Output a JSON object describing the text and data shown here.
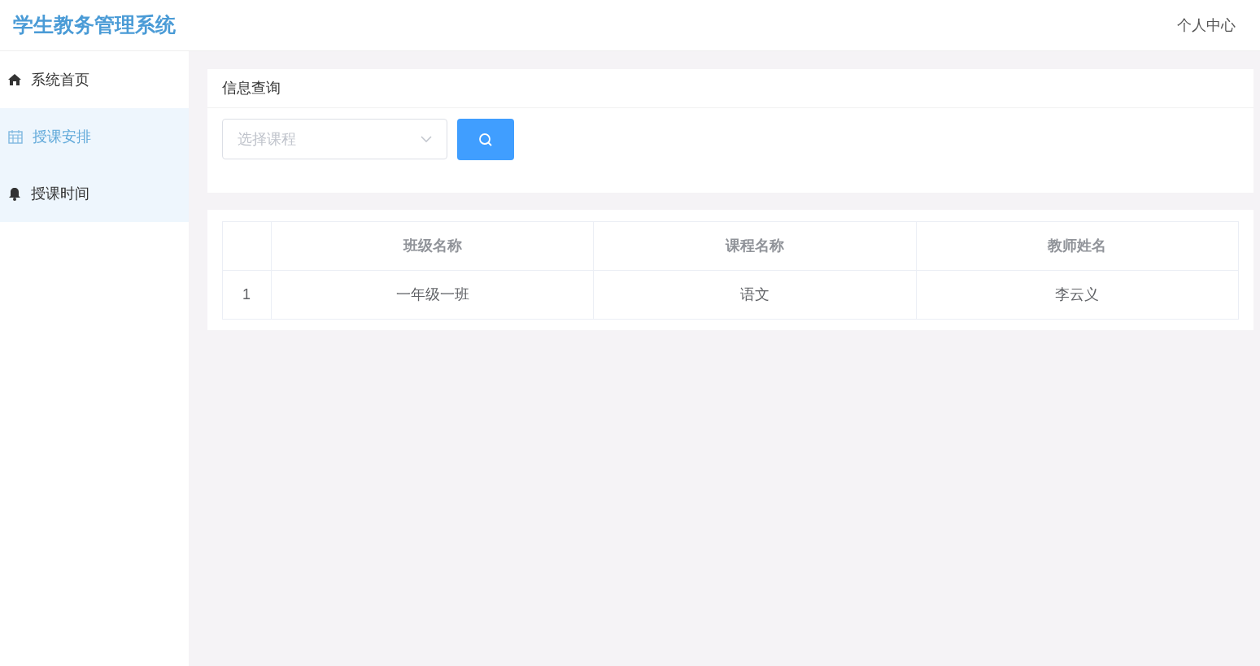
{
  "header": {
    "title": "学生教务管理系统",
    "user_menu": "个人中心"
  },
  "sidebar": {
    "items": [
      {
        "label": "系统首页",
        "kind": "home",
        "selected": false,
        "hovered": false
      },
      {
        "label": "授课安排",
        "kind": "calendar",
        "selected": true,
        "hovered": false
      },
      {
        "label": "授课时间",
        "kind": "bell",
        "selected": false,
        "hovered": true
      }
    ]
  },
  "search_card": {
    "title": "信息查询",
    "course_select": {
      "placeholder": "选择课程"
    }
  },
  "table": {
    "columns": [
      "",
      "班级名称",
      "课程名称",
      "教师姓名"
    ],
    "rows": [
      [
        "1",
        "一年级一班",
        "语文",
        "李云义"
      ]
    ]
  }
}
